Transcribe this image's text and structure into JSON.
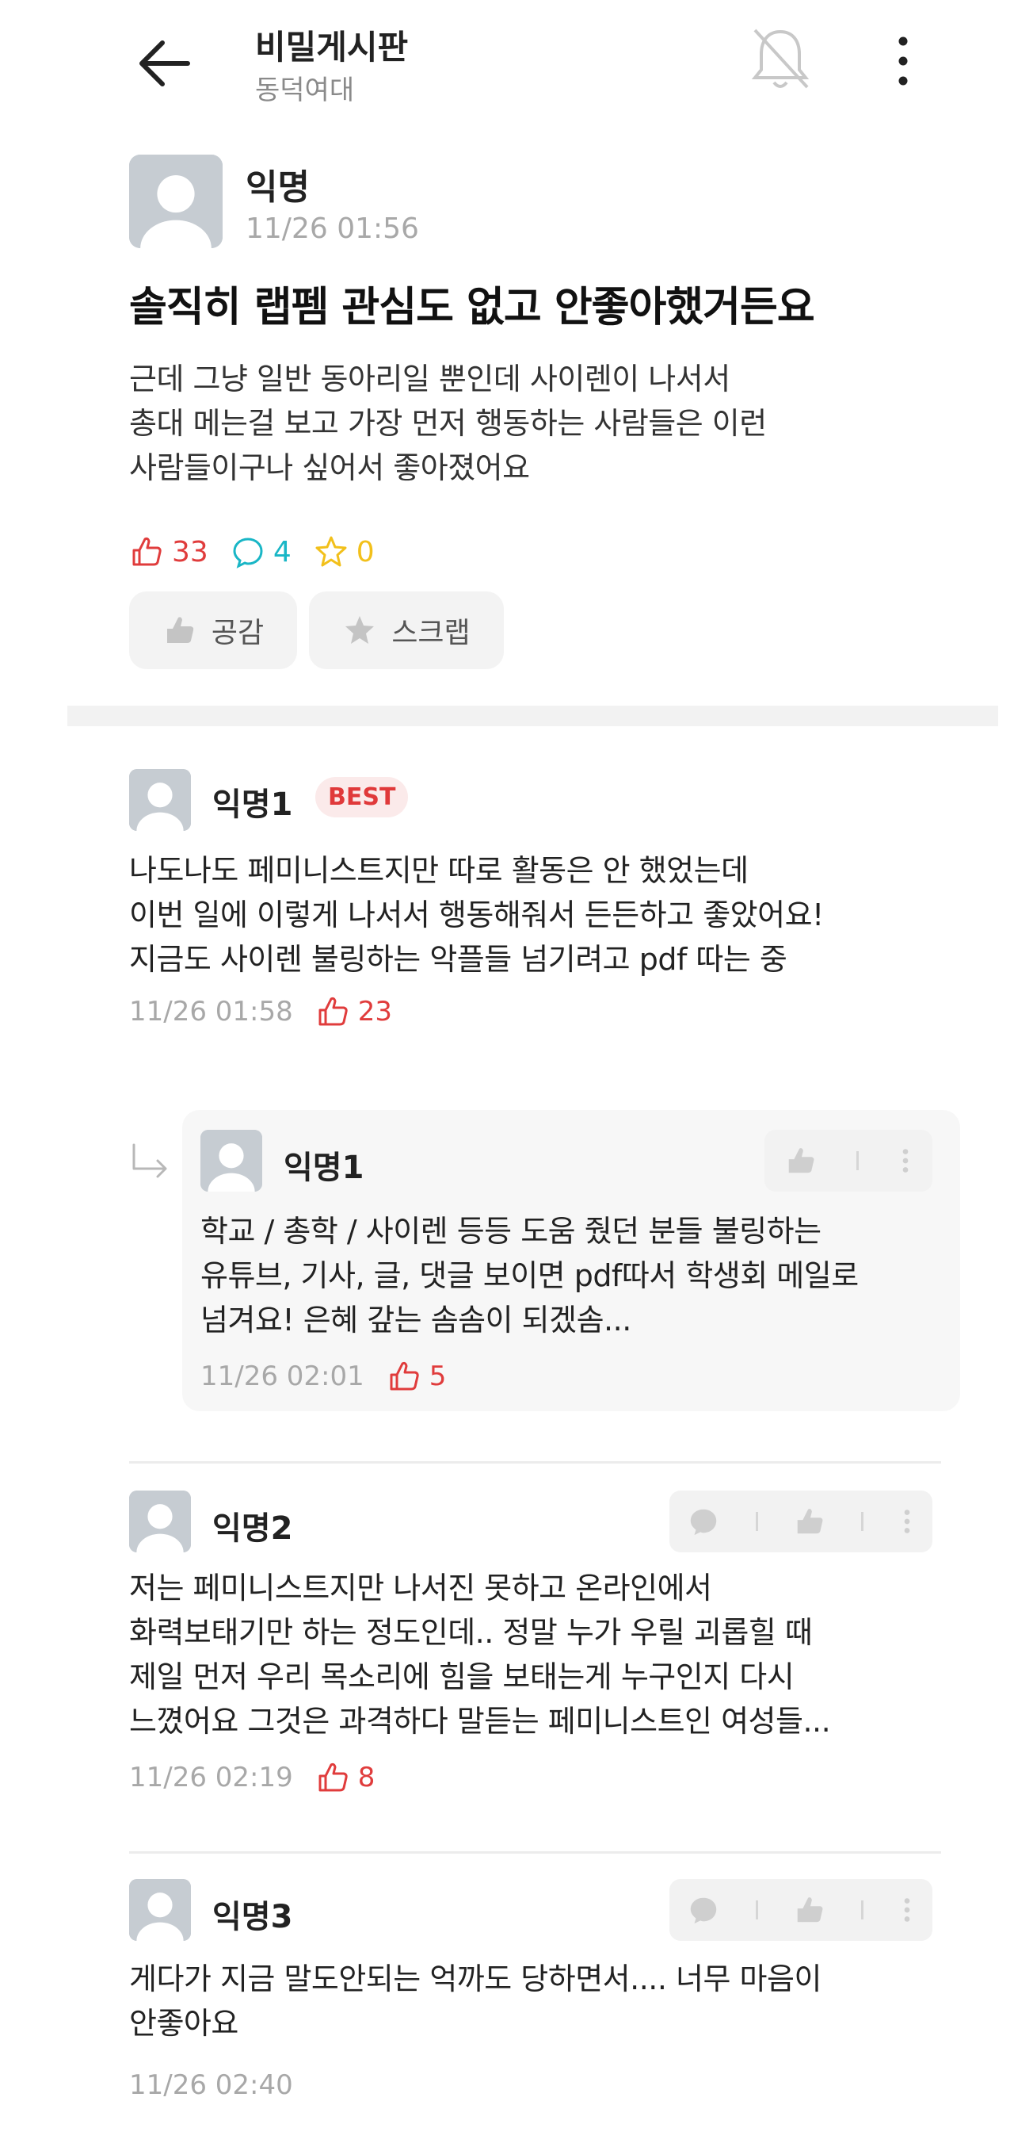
{
  "header": {
    "title": "비밀게시판",
    "subtitle": "동덕여대"
  },
  "post": {
    "author": "익명",
    "time": "11/26 01:56",
    "title": "솔직히 랩펨 관심도 없고 안좋아했거든요",
    "body_lines": [
      "근데 그냥 일반 동아리일 뿐인데 사이렌이 나서서",
      "총대 메는걸 보고 가장 먼저 행동하는 사람들은 이런",
      "사람들이구나 싶어서 좋아졌어요"
    ],
    "likes": "33",
    "comments": "4",
    "scraps": "0",
    "like_button": "공감",
    "scrap_button": "스크랩"
  },
  "comments": [
    {
      "name": "익명1",
      "badge": "BEST",
      "lines": [
        "나도나도 페미니스트지만 따로 활동은 안 했었는데",
        "이번 일에 이렇게 나서서 행동해줘서 든든하고 좋았어요!",
        "지금도 사이렌 불링하는 악플들 넘기려고 pdf 따는 중"
      ],
      "time": "11/26 01:58",
      "likes": "23"
    },
    {
      "name": "익명1",
      "lines": [
        "학교 / 총학 / 사이렌 등등 도움 줬던 분들 불링하는",
        "유튜브, 기사, 글, 댓글 보이면 pdf따서 학생회 메일로",
        "넘겨요! 은혜 갚는 솜솜이 되겠솜..."
      ],
      "time": "11/26 02:01",
      "likes": "5"
    },
    {
      "name": "익명2",
      "lines": [
        "저는 페미니스트지만 나서진 못하고 온라인에서",
        "화력보태기만 하는 정도인데.. 정말 누가 우릴 괴롭힐 때",
        "제일 먼저 우리 목소리에 힘을 보태는게 누구인지 다시",
        "느꼈어요 그것은 과격하다 말듣는 페미니스트인 여성들..."
      ],
      "time": "11/26 02:19",
      "likes": "8"
    },
    {
      "name": "익명3",
      "lines": [
        "게다가 지금 말도안되는 억까도 당하면서.... 너무 마음이",
        "안좋아요"
      ],
      "time": "11/26 02:40"
    }
  ]
}
